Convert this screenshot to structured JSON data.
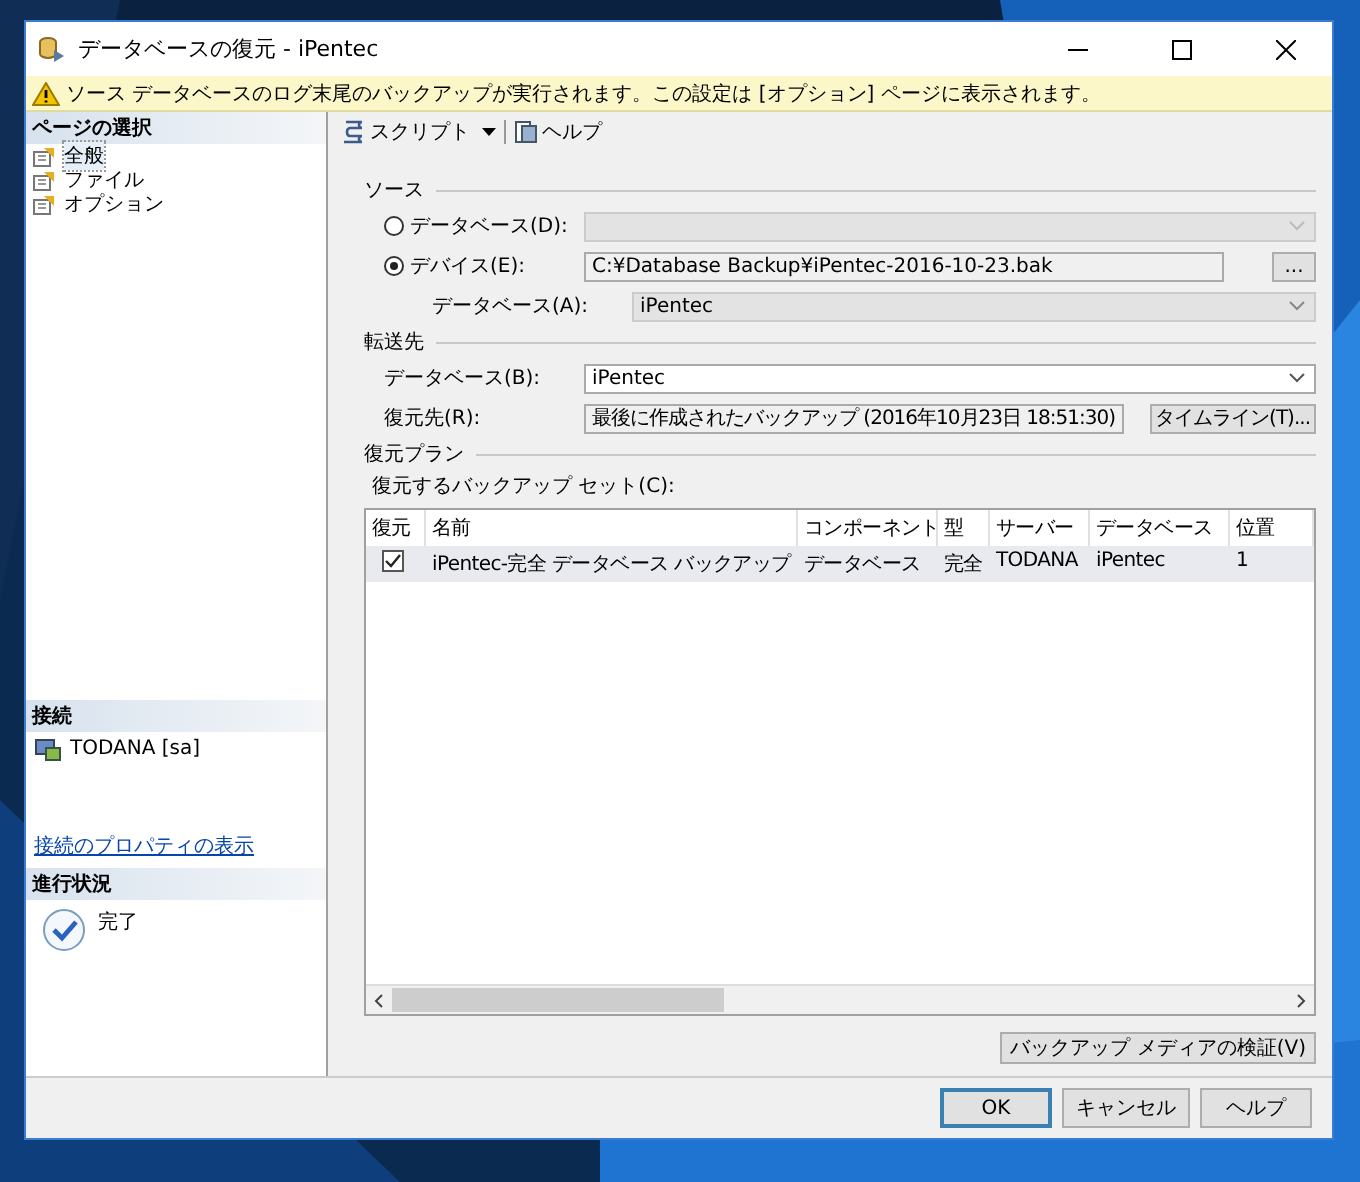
{
  "window": {
    "title": "データベースの復元 - iPentec"
  },
  "warning": "ソース データベースのログ末尾のバックアップが実行されます。この設定は [オプション] ページに表示されます。",
  "sidebar": {
    "header": "ページの選択",
    "pages": [
      {
        "label": "全般",
        "selected": true
      },
      {
        "label": "ファイル",
        "selected": false
      },
      {
        "label": "オプション",
        "selected": false
      }
    ],
    "connection": {
      "header": "接続",
      "server": "TODANA [sa]",
      "link": "接続のプロパティの表示"
    },
    "progress": {
      "header": "進行状況",
      "status": "完了"
    }
  },
  "toolbar": [
    {
      "label": "スクリプト",
      "kind": "dropdown"
    },
    {
      "label": "ヘルプ",
      "kind": "help"
    }
  ],
  "source": {
    "title": "ソース",
    "options": [
      {
        "label": "データベース(D):",
        "selected": false
      },
      {
        "label": "デバイス(E):",
        "selected": true,
        "value": "C:¥Database Backup¥iPentec-2016-10-23.bak"
      }
    ],
    "browse": "...",
    "database_label": "データベース(A):",
    "database": "iPentec"
  },
  "destination": {
    "title": "転送先",
    "database_label": "データベース(B):",
    "database": "iPentec",
    "restore_to_label": "復元先(R):",
    "restore_to": "最後に作成されたバックアップ (2016年10月23日 18:51:30)",
    "timeline_button": "タイムライン(T)..."
  },
  "plan": {
    "title": "復元プラン",
    "grid_label": "復元するバックアップ セット(C):",
    "check_column": "復元",
    "columns": [
      "名前",
      "コンポーネント",
      "型",
      "サーバー",
      "データベース",
      "位置"
    ],
    "rows": [
      {
        "checked": true,
        "cells": [
          "iPentec-完全 データベース バックアップ",
          "データベース",
          "完全",
          "TODANA",
          "iPentec",
          "1"
        ]
      }
    ]
  },
  "verify_button": "バックアップ メディアの検証(V)",
  "buttons": [
    "OK",
    "キャンセル",
    "ヘルプ"
  ]
}
